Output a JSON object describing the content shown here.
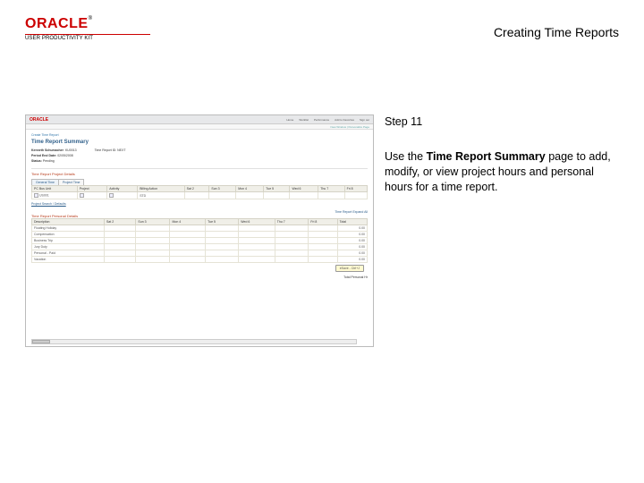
{
  "logo": {
    "brand": "ORACLE",
    "tm": "®",
    "subline": "USER PRODUCTIVITY KIT"
  },
  "doc_title": "Creating Time Reports",
  "step_label": "Step 11",
  "instruction_pre": "Use the ",
  "instruction_bold": "Time Report Summary",
  "instruction_post": " page to add, modify, or view project hours and personal hours for a time report.",
  "shot": {
    "nav": {
      "home": "Home",
      "worklist": "Worklist",
      "performance": "Performance",
      "addfav": "Add to Favorites",
      "signout": "Sign out"
    },
    "subnav": "New Window | Personalize Page",
    "crumb": "Create Time Report",
    "h1": "Time Report Summary",
    "meta": {
      "name_label": "Kenneth Schumacher",
      "name_value": "KU0013",
      "tr_label": "Time Report ID:",
      "tr_value": "NEXT",
      "pe_label": "Period End Date:",
      "pe_value": "02/05/2008",
      "status_label": "Status:",
      "status_value": "Pending"
    },
    "section1": {
      "title": "Time Report Project Details",
      "tab1": "General Time",
      "tab2": "Project Time",
      "cols": [
        "PC Bus Unit",
        "Project",
        "Activity",
        "Billing Action",
        "Sat 2",
        "Sun 3",
        "Mon 4",
        "Tue 5",
        "Wed 6",
        "Thu 7",
        "Fri 8"
      ],
      "row_bu": "US001",
      "row_act": "",
      "row_bill": "STD",
      "link": "Project Search / Defaults"
    },
    "section2": {
      "title": "Time Report Personal Details",
      "sidecol": "Time Report Expand All",
      "cols": [
        "Description",
        "Sat 2",
        "Sun 3",
        "Mon 4",
        "Tue 5",
        "Wed 6",
        "Thu 7",
        "Fri 8",
        "Total"
      ],
      "rows": [
        "Floating Holiday",
        "Compensation",
        "Business Trip",
        "Jury Duty",
        "Personal - Paid",
        "Vacation"
      ],
      "zero": "0.00"
    },
    "save_btn": "eSave - Ctrl+J",
    "total_label": "Total Personal Hr"
  }
}
